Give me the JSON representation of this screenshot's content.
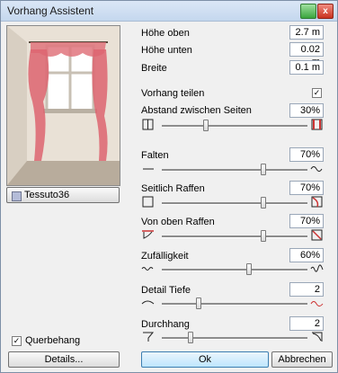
{
  "window": {
    "title": "Vorhang Assistent",
    "close_symbol": "x"
  },
  "material": {
    "label": "Tessuto36",
    "swatch_color": "#b4bcd8"
  },
  "fields": [
    {
      "label": "Höhe oben",
      "value": "2.7 m"
    },
    {
      "label": "Höhe unten",
      "value": "0.02 m"
    },
    {
      "label": "Breite",
      "value": "0.1 m"
    }
  ],
  "split": {
    "label": "Vorhang teilen",
    "checked": true,
    "check_mark": "✓"
  },
  "sliders": [
    {
      "label": "Abstand zwischen Seiten",
      "value": "30%",
      "level": 0.3,
      "left_icon": "curtain-closed-icon",
      "right_icon": "curtain-open-icon"
    },
    {
      "label": "Falten",
      "value": "70%",
      "level": 0.7,
      "left_icon": "flat-line-icon",
      "right_icon": "wave-icon"
    },
    {
      "label": "Seitlich Raffen",
      "value": "70%",
      "level": 0.7,
      "left_icon": "square-icon",
      "right_icon": "side-gather-icon"
    },
    {
      "label": "Von oben Raffen",
      "value": "70%",
      "level": 0.7,
      "left_icon": "top-gather-left-icon",
      "right_icon": "top-gather-right-icon"
    },
    {
      "label": "Zufälligkeit",
      "value": "60%",
      "level": 0.6,
      "left_icon": "small-wave-icon",
      "right_icon": "random-wave-icon"
    },
    {
      "label": "Detail Tiefe",
      "value": "2",
      "level": 0.25,
      "left_icon": "smooth-curve-icon",
      "right_icon": "detail-curve-icon"
    },
    {
      "label": "Durchhang",
      "value": "2",
      "level": 0.2,
      "left_icon": "sag-left-icon",
      "right_icon": "sag-right-icon"
    }
  ],
  "valance": {
    "label": "Querbehang",
    "checked": true,
    "check_mark": "✓"
  },
  "buttons": {
    "details": "Details...",
    "ok": "Ok",
    "cancel": "Abbrechen"
  }
}
